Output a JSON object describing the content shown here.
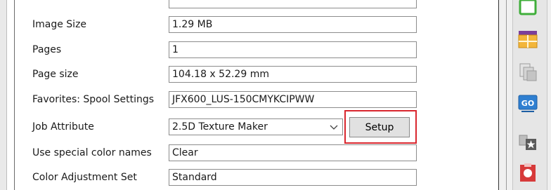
{
  "properties": [
    {
      "label": "Image Size",
      "value": "1.29 MB"
    },
    {
      "label": "Pages",
      "value": "1"
    },
    {
      "label": "Page size",
      "value": "104.18 x 52.29 mm"
    },
    {
      "label": "Favorites: Spool Settings",
      "value": "JFX600_LUS-150CMYKCIPWW"
    },
    {
      "label": "Job Attribute",
      "value": "2.5D Texture Maker"
    },
    {
      "label": "Use special color names",
      "value": "Clear"
    },
    {
      "label": "Color Adjustment Set",
      "value": "Standard"
    }
  ],
  "setup_button": {
    "label": "Setup"
  },
  "toolbar": {
    "icons": [
      "green-frame-icon",
      "table-grid-icon",
      "copy-pages-icon",
      "go-button-icon",
      "star-favorite-icon",
      "red-clip-icon"
    ],
    "go_label": "GO"
  },
  "colors": {
    "highlight": "#d9262e"
  }
}
